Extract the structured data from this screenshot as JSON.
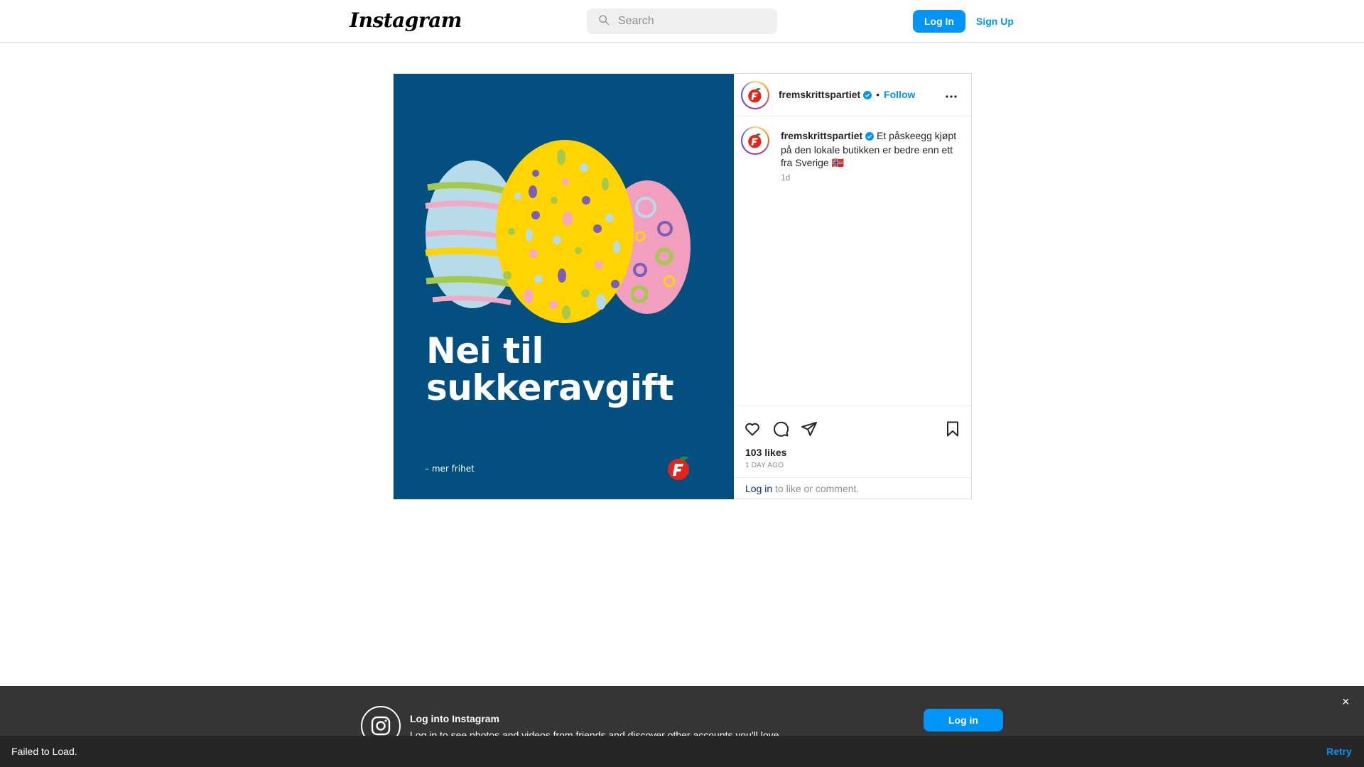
{
  "header": {
    "logo": "Instagram",
    "search_placeholder": "Search",
    "login_label": "Log In",
    "signup_label": "Sign Up"
  },
  "post": {
    "image": {
      "headline_line1": "Nei til",
      "headline_line2": "sukkeravgift",
      "tagline": "– mer frihet"
    },
    "author": {
      "username": "fremskrittspartiet",
      "verified": true,
      "follow_label": "Follow"
    },
    "caption": {
      "username": "fremskrittspartiet",
      "text": "Et påskeegg kjøpt på den lokale butikken er bedre enn ett fra Sverige 🇳🇴",
      "time": "1d"
    },
    "likes": "103 likes",
    "ago": "1 DAY AGO",
    "login_link": "Log in",
    "login_rest": " to like or comment."
  },
  "banner": {
    "title": "Log into Instagram",
    "subtitle": "Log in to see photos and videos from friends and discover other accounts you'll love.",
    "button": "Log in",
    "close": "×"
  },
  "toast": {
    "message": "Failed to Load.",
    "retry": "Retry"
  },
  "colors": {
    "accent": "#0095f6",
    "media_bg": "#034f80"
  }
}
